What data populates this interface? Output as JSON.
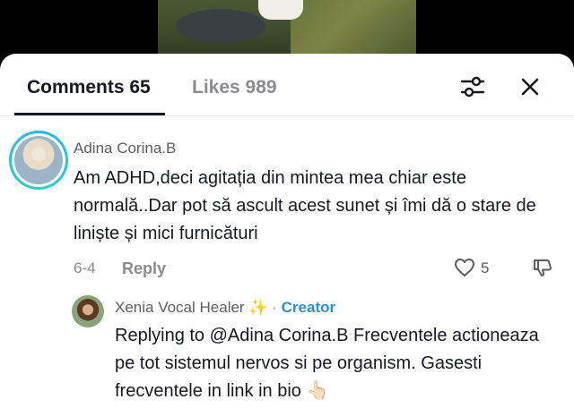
{
  "tabs": {
    "comments_label": "Comments 65",
    "likes_label": "Likes 989"
  },
  "comment": {
    "username": "Adina Corina.B",
    "text": "Am ADHD,deci agitația din mintea mea chiar este normală..Dar pot să ascult acest sunet și îmi dă o stare de liniște și mici furnicături",
    "date": "6-4",
    "reply_label": "Reply",
    "like_count": "5"
  },
  "reply": {
    "username": "Xenia Vocal Healer",
    "sparkle": "✨",
    "separator": "·",
    "badge": "Creator",
    "text": "Replying to @Adina Corina.B Frecventele actioneaza pe tot sistemul nervos si pe organism. Gasesti frecventele in link in bio 👆🏻"
  },
  "colors": {
    "accent_creator": "#2e8fd6",
    "avatar_ring": "#2ab7e6"
  },
  "icons": [
    "filter-sliders-icon",
    "close-icon",
    "heart-icon",
    "thumbs-down-icon"
  ]
}
